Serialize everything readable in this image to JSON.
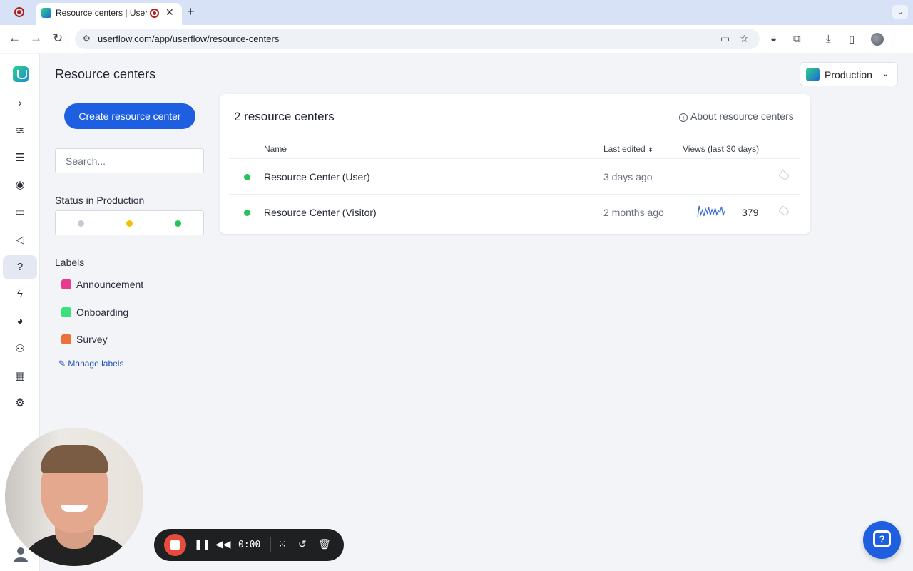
{
  "browser": {
    "tab_title": "Resource centers | Userflow",
    "url": "userflow.com/app/userflow/resource-centers",
    "icons": [
      "record-icon",
      "close-icon",
      "plus-icon",
      "chevron-down-icon",
      "back-icon",
      "forward-icon",
      "reload-icon",
      "site-settings-icon",
      "camera-icon",
      "star-icon",
      "extension-icon",
      "puzzle-icon",
      "download-icon",
      "sidepanel-icon",
      "profile-avatar"
    ]
  },
  "rail": {
    "icons": [
      "userflow-logo",
      "chevron-right-icon",
      "flows-icon",
      "checklists-icon",
      "launchers-icon",
      "banners-icon",
      "announcements-icon",
      "resource-center-icon",
      "actions-icon",
      "analytics-icon",
      "users-icon",
      "companies-icon",
      "settings-icon",
      "user-avatar-icon"
    ],
    "active": "resource-center-icon"
  },
  "header": {
    "title": "Resource centers",
    "environment": "Production"
  },
  "sidebar": {
    "create_label": "Create resource center",
    "search_placeholder": "Search...",
    "status_heading": "Status in Production",
    "status_dots": [
      {
        "name": "draft",
        "color": "#c5cad3"
      },
      {
        "name": "changed",
        "color": "#f2c100"
      },
      {
        "name": "live",
        "color": "#27c25a"
      }
    ],
    "labels_heading": "Labels",
    "labels": [
      {
        "text": "Announcement",
        "color": "#e6398f"
      },
      {
        "text": "Onboarding",
        "color": "#3ee07e"
      },
      {
        "text": "Survey",
        "color": "#ef6f3a"
      }
    ],
    "manage_labels": "Manage labels"
  },
  "table": {
    "title": "2 resource centers",
    "about_link": "About resource centers",
    "columns": [
      "Name",
      "Last edited",
      "Views (last 30 days)"
    ],
    "rows": [
      {
        "name": "Resource Center (User)",
        "last_edited": "3 days ago",
        "views": "",
        "status_color": "#27c25a",
        "sparkline": []
      },
      {
        "name": "Resource Center (Visitor)",
        "last_edited": "2 months ago",
        "views": "379",
        "status_color": "#27c25a",
        "sparkline": [
          2,
          18,
          6,
          12,
          4,
          14,
          8,
          16,
          5,
          13,
          7,
          15,
          6,
          12,
          9,
          17,
          5,
          11
        ]
      }
    ]
  },
  "recorder": {
    "time": "0:00",
    "controls": [
      "stop-icon",
      "pause-icon",
      "rewind-icon",
      "grid-icon",
      "restart-icon",
      "trash-icon"
    ]
  },
  "colors": {
    "accent": "#1d5fe0",
    "live": "#27c25a"
  }
}
